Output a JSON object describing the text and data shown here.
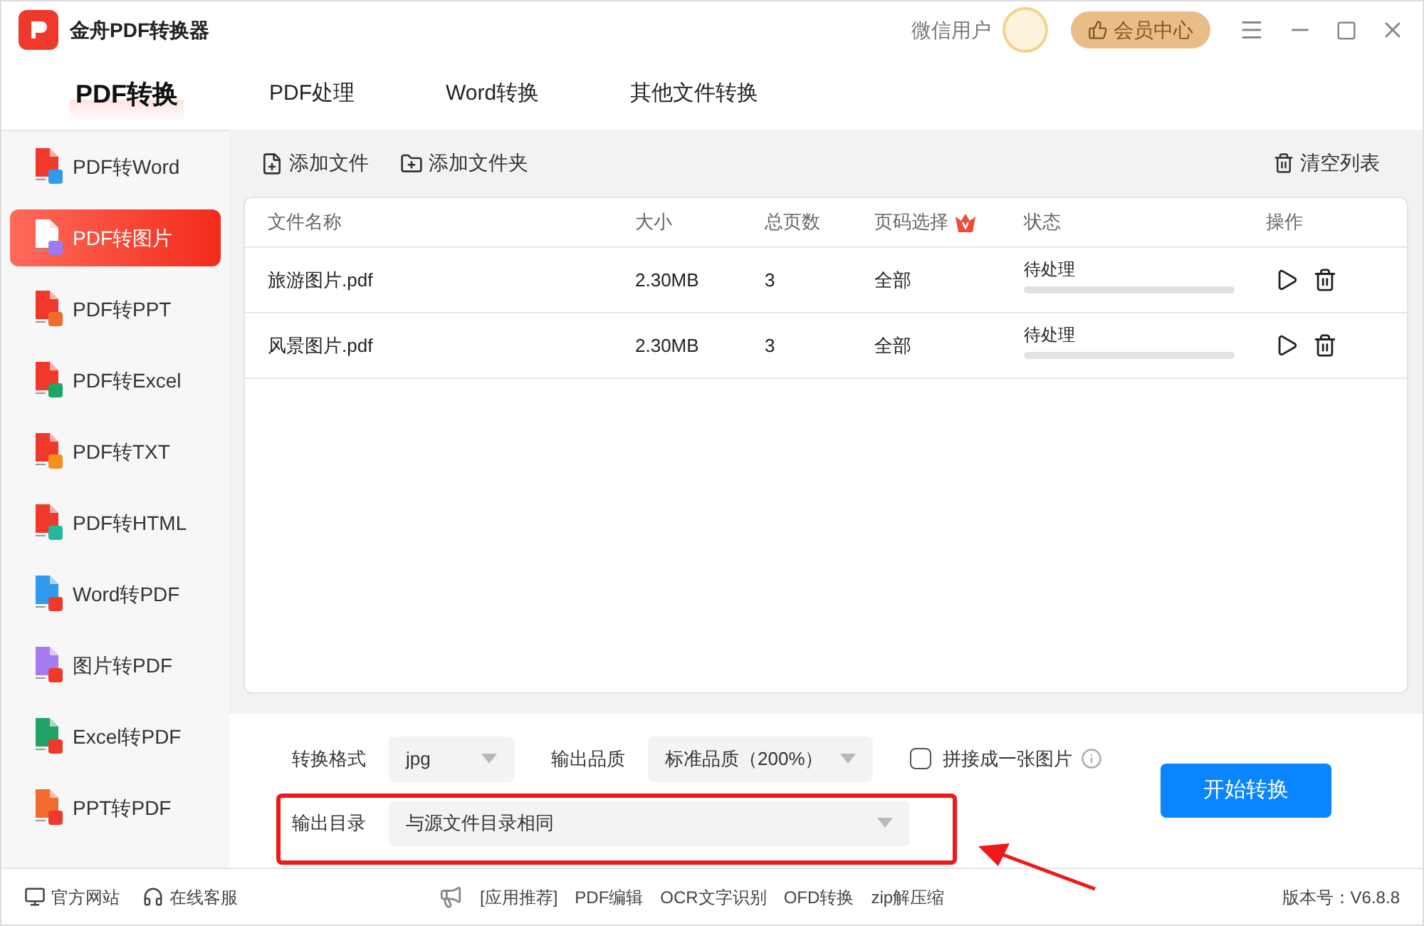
{
  "window": {
    "title": "金舟PDF转换器",
    "user": "微信用户",
    "vip_button": "会员中心"
  },
  "tabs": [
    {
      "label": "PDF转换",
      "selected": true
    },
    {
      "label": "PDF处理",
      "selected": false
    },
    {
      "label": "Word转换",
      "selected": false
    },
    {
      "label": "其他文件转换",
      "selected": false
    }
  ],
  "sidebar": {
    "items": [
      {
        "label": "PDF转Word",
        "selected": false,
        "kind": "from_pdf",
        "color": "#2f9bf0"
      },
      {
        "label": "PDF转图片",
        "selected": true,
        "kind": "from_pdf",
        "color": "#9b7cf0"
      },
      {
        "label": "PDF转PPT",
        "selected": false,
        "kind": "from_pdf",
        "color": "#f26b2e"
      },
      {
        "label": "PDF转Excel",
        "selected": false,
        "kind": "from_pdf",
        "color": "#1fa463"
      },
      {
        "label": "PDF转TXT",
        "selected": false,
        "kind": "from_pdf",
        "color": "#f5901e"
      },
      {
        "label": "PDF转HTML",
        "selected": false,
        "kind": "from_pdf",
        "color": "#22b89a"
      },
      {
        "label": "Word转PDF",
        "selected": false,
        "kind": "to_pdf",
        "color": "#2f9bf0"
      },
      {
        "label": "图片转PDF",
        "selected": false,
        "kind": "to_pdf",
        "color": "#a57cf0"
      },
      {
        "label": "Excel转PDF",
        "selected": false,
        "kind": "to_pdf",
        "color": "#1fa463"
      },
      {
        "label": "PPT转PDF",
        "selected": false,
        "kind": "to_pdf",
        "color": "#f26b2e"
      }
    ]
  },
  "toolbar": {
    "add_file": "添加文件",
    "add_folder": "添加文件夹",
    "clear_list": "清空列表"
  },
  "table": {
    "columns": [
      "文件名称",
      "大小",
      "总页数",
      "页码选择",
      "状态",
      "操作"
    ],
    "rows": [
      {
        "name": "旅游图片.pdf",
        "size": "2.30MB",
        "pages": "3",
        "range": "全部",
        "status": "待处理",
        "level": 0
      },
      {
        "name": "风景图片.pdf",
        "size": "2.30MB",
        "pages": "3",
        "range": "全部",
        "status": "待处理",
        "level": 0
      }
    ]
  },
  "settings": {
    "format_label": "转换格式",
    "format": "jpg",
    "quality_label": "输出品质",
    "quality": "标准品质（200%）",
    "merge": {
      "label": "拼接成一张图片",
      "checked": false
    },
    "output_label": "输出目录",
    "output": "与源文件目录相同",
    "start_button": "开始转换"
  },
  "status_bar": {
    "left": [
      "官方网站",
      "在线客服"
    ],
    "center": [
      "[应用推荐]",
      "PDF编辑",
      "OCR文字识别",
      "OFD转换",
      "zip解压缩"
    ],
    "version": "版本号：V6.8.8"
  }
}
